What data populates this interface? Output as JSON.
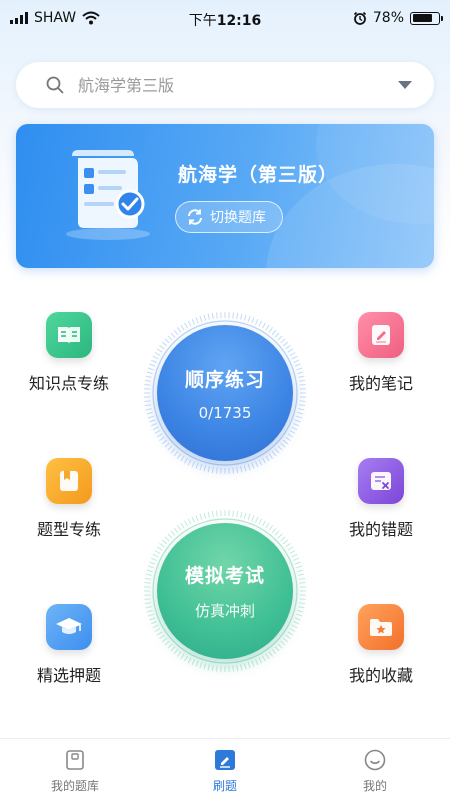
{
  "status_bar": {
    "carrier": "SHAW",
    "time_prefix": "下午",
    "time": "12:16",
    "battery": "78%",
    "battery_level": 0.78
  },
  "search": {
    "placeholder": "航海学第三版"
  },
  "banner": {
    "title": "航海学（第三版）",
    "switch_label": "切换题库"
  },
  "features": {
    "knowledge": "知识点专练",
    "question_type": "题型专练",
    "selected": "精选押题",
    "notes": "我的笔记",
    "mistakes": "我的错题",
    "favorites": "我的收藏"
  },
  "practice": {
    "title": "顺序练习",
    "progress": "0/1735",
    "done": 0,
    "total": 1735
  },
  "exam": {
    "title": "模拟考试",
    "subtitle": "仿真冲刺"
  },
  "tabbar": {
    "items": [
      {
        "label": "我的题库",
        "icon": "book-icon"
      },
      {
        "label": "刷题",
        "icon": "pen-icon",
        "active": true
      },
      {
        "label": "我的",
        "icon": "smiley-icon"
      }
    ]
  },
  "colors": {
    "accent": "#2f7ad8",
    "practice_circle": "#3c84e4",
    "exam_circle": "#3fbf95",
    "knowledge_icon": "#34c48c",
    "question_type_icon": "#f5a623",
    "selected_icon": "#4a9bf0",
    "notes_icon": "#f3708d",
    "mistakes_icon": "#8a54e0",
    "favorites_icon": "#f5833a"
  }
}
